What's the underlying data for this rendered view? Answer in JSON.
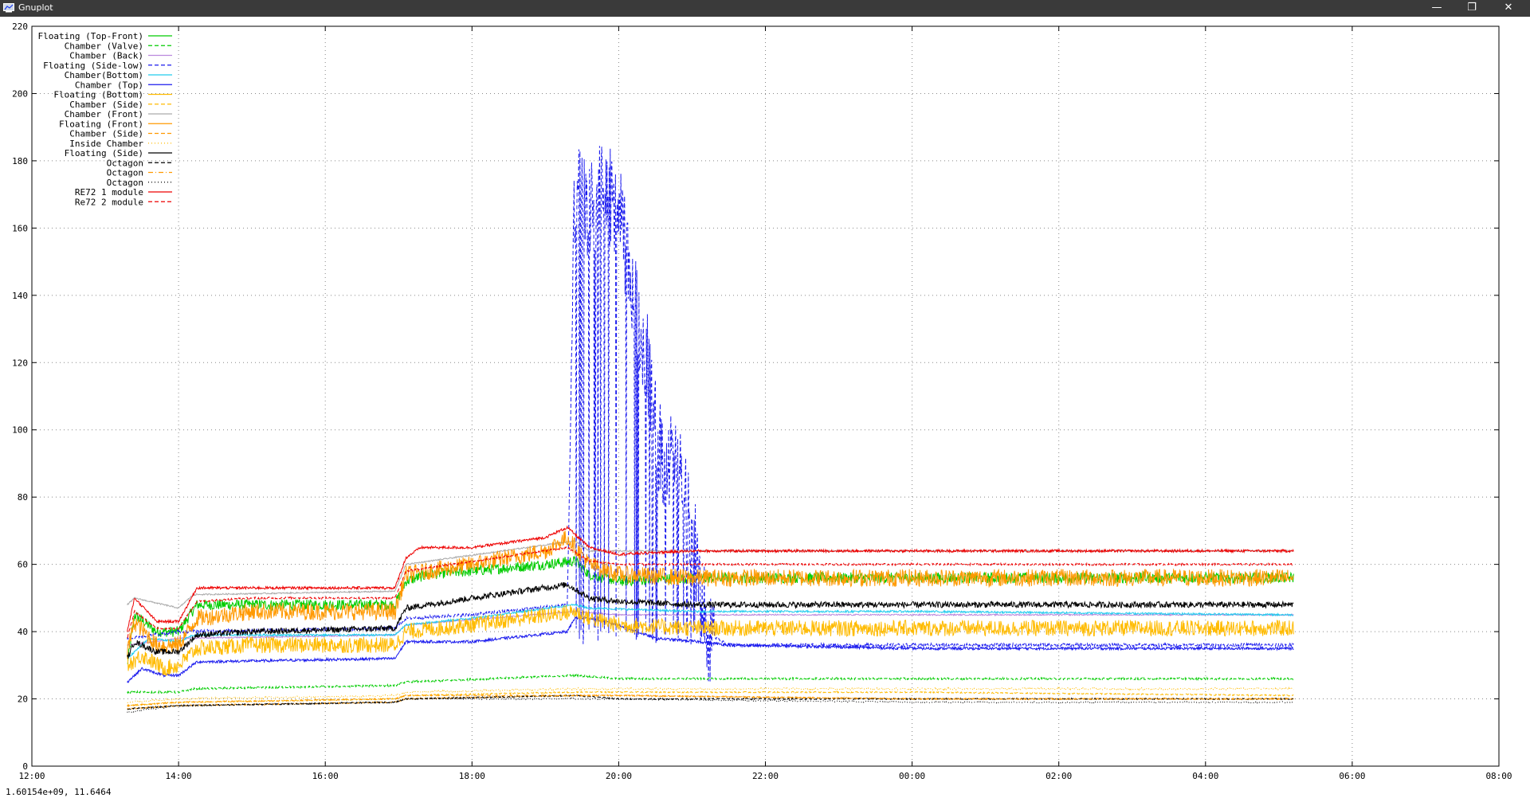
{
  "window": {
    "title": "Gnuplot",
    "minimize_icon": "minimize-icon",
    "restore_icon": "restore-icon",
    "close_icon": "close-icon"
  },
  "status": {
    "text": "1.60154e+09,  11.6464"
  },
  "chart_data": {
    "type": "line",
    "title": "",
    "xlabel": "",
    "ylabel": "",
    "x_unit": "hours since 12:00",
    "xlim": [
      0,
      20
    ],
    "ylim": [
      0,
      220
    ],
    "xticks": [
      "12:00",
      "14:00",
      "16:00",
      "18:00",
      "20:00",
      "22:00",
      "00:00",
      "02:00",
      "04:00",
      "06:00",
      "08:00"
    ],
    "yticks": [
      "0",
      "20",
      "40",
      "60",
      "80",
      "100",
      "120",
      "140",
      "160",
      "180",
      "200",
      "220"
    ],
    "grid": true,
    "legend_position": "top-left",
    "series": [
      {
        "name": "Floating (Top-Front)",
        "color": "#00cc00",
        "dash": "solid",
        "noise": 1.6,
        "points": [
          [
            1.3,
            30
          ],
          [
            1.4,
            45
          ],
          [
            1.7,
            40
          ],
          [
            2.0,
            40
          ],
          [
            2.25,
            48
          ],
          [
            3,
            48
          ],
          [
            4,
            48
          ],
          [
            4.95,
            48
          ],
          [
            5.1,
            55
          ],
          [
            5.4,
            57
          ],
          [
            6,
            58
          ],
          [
            7,
            60
          ],
          [
            7.4,
            61
          ],
          [
            7.6,
            57
          ],
          [
            8,
            55
          ],
          [
            9,
            56
          ],
          [
            11,
            56
          ],
          [
            13,
            56
          ],
          [
            15,
            56
          ],
          [
            17.2,
            56
          ]
        ]
      },
      {
        "name": "Chamber (Valve)",
        "color": "#00cc00",
        "dash": "dash",
        "noise": 0.3,
        "points": [
          [
            1.3,
            22
          ],
          [
            2,
            22
          ],
          [
            2.2,
            23
          ],
          [
            4.95,
            24
          ],
          [
            5.1,
            25
          ],
          [
            7.4,
            27
          ],
          [
            8,
            26
          ],
          [
            12,
            26
          ],
          [
            17.2,
            26
          ]
        ]
      },
      {
        "name": "Chamber (Back)",
        "color": "#bb88dd",
        "dash": "solid",
        "noise": 0.2,
        "points": [
          [
            1.3,
            36
          ],
          [
            2,
            38
          ],
          [
            4.95,
            39
          ],
          [
            5.1,
            42
          ],
          [
            7.4,
            46
          ],
          [
            8,
            45
          ],
          [
            12,
            45
          ],
          [
            17.2,
            45
          ]
        ]
      },
      {
        "name": "Floating (Side-low)",
        "color": "#1a1aee",
        "dash": "dash",
        "noise": 0.5,
        "spiky": true,
        "points": [
          [
            1.3,
            38
          ],
          [
            2,
            40
          ],
          [
            4.95,
            41
          ],
          [
            5.1,
            44
          ],
          [
            6,
            45
          ],
          [
            7.3,
            48
          ],
          [
            7.4,
            170
          ],
          [
            7.6,
            165
          ],
          [
            7.8,
            172
          ],
          [
            8,
            165
          ],
          [
            8.2,
            140
          ],
          [
            8.4,
            120
          ],
          [
            8.5,
            100
          ],
          [
            8.6,
            92
          ],
          [
            8.8,
            90
          ],
          [
            9,
            70
          ],
          [
            9.2,
            40
          ],
          [
            9.4,
            37
          ],
          [
            9.5,
            36
          ],
          [
            10,
            36
          ],
          [
            12,
            36
          ],
          [
            17.2,
            36
          ]
        ]
      },
      {
        "name": "Chamber(Bottom)",
        "color": "#22ccee",
        "dash": "solid",
        "noise": 0.3,
        "points": [
          [
            1.3,
            32
          ],
          [
            1.6,
            38
          ],
          [
            2,
            37
          ],
          [
            2.2,
            39
          ],
          [
            4.95,
            39
          ],
          [
            5.1,
            42
          ],
          [
            6,
            44
          ],
          [
            7.4,
            48
          ],
          [
            7.6,
            47
          ],
          [
            9,
            46
          ],
          [
            12,
            46
          ],
          [
            17.2,
            45
          ]
        ]
      },
      {
        "name": "Chamber (Top)",
        "color": "#1a1aee",
        "dash": "solid",
        "noise": 0.4,
        "points": [
          [
            1.3,
            25
          ],
          [
            1.5,
            29
          ],
          [
            1.8,
            27
          ],
          [
            2.0,
            27
          ],
          [
            2.25,
            31
          ],
          [
            4.95,
            32
          ],
          [
            5.1,
            37
          ],
          [
            6,
            37
          ],
          [
            7.3,
            40
          ],
          [
            7.4,
            44
          ],
          [
            7.6,
            44
          ],
          [
            8,
            42
          ],
          [
            8.5,
            38
          ],
          [
            9.1,
            37
          ],
          [
            9.5,
            36
          ],
          [
            12,
            35
          ],
          [
            17.2,
            35
          ]
        ]
      },
      {
        "name": "Floating (Bottom)",
        "color": "#ffbb00",
        "dash": "solid",
        "noise": 2.4,
        "points": [
          [
            1.3,
            30
          ],
          [
            1.5,
            33
          ],
          [
            1.8,
            29
          ],
          [
            2.0,
            30
          ],
          [
            2.25,
            35
          ],
          [
            3,
            36
          ],
          [
            4.95,
            36
          ],
          [
            5.1,
            40
          ],
          [
            6,
            42
          ],
          [
            7.4,
            46
          ],
          [
            7.6,
            44
          ],
          [
            8,
            42
          ],
          [
            9,
            41
          ],
          [
            12,
            41
          ],
          [
            17.2,
            41
          ]
        ]
      },
      {
        "name": "Chamber (Side)",
        "color": "#ffbb00",
        "dash": "dash",
        "noise": 0.2,
        "points": [
          [
            1.3,
            18
          ],
          [
            2,
            19
          ],
          [
            4.95,
            20
          ],
          [
            5.1,
            21
          ],
          [
            7.4,
            22
          ],
          [
            8,
            22
          ],
          [
            12,
            22
          ],
          [
            17.2,
            21
          ]
        ]
      },
      {
        "name": "Chamber (Front)",
        "color": "#aaaaaa",
        "dash": "solid",
        "noise": 0.2,
        "points": [
          [
            1.3,
            48
          ],
          [
            1.4,
            50
          ],
          [
            2,
            47
          ],
          [
            2.2,
            51
          ],
          [
            4.95,
            52
          ],
          [
            5.1,
            60
          ],
          [
            7.4,
            67
          ],
          [
            7.6,
            64
          ],
          [
            8,
            64
          ],
          [
            12,
            64
          ],
          [
            17.2,
            64
          ]
        ]
      },
      {
        "name": "Floating (Front)",
        "color": "#ff9900",
        "dash": "solid",
        "noise": 2.6,
        "points": [
          [
            1.3,
            34
          ],
          [
            1.4,
            43
          ],
          [
            1.7,
            36
          ],
          [
            2.0,
            36
          ],
          [
            2.25,
            44
          ],
          [
            3,
            46
          ],
          [
            4.95,
            46
          ],
          [
            5.1,
            57
          ],
          [
            6,
            60
          ],
          [
            7,
            64
          ],
          [
            7.3,
            68
          ],
          [
            7.6,
            60
          ],
          [
            8,
            57
          ],
          [
            9,
            56
          ],
          [
            12,
            56
          ],
          [
            17.2,
            56
          ]
        ]
      },
      {
        "name": "Chamber (Side)",
        "color": "#ff9900",
        "dash": "dash",
        "noise": 0.2,
        "points": [
          [
            1.3,
            17
          ],
          [
            2,
            18
          ],
          [
            4.95,
            19
          ],
          [
            5.1,
            20
          ],
          [
            7.4,
            21
          ],
          [
            8,
            21
          ],
          [
            12,
            20
          ],
          [
            17.2,
            20
          ]
        ]
      },
      {
        "name": "Inside Chamber",
        "color": "#ffbb00",
        "dash": "dot",
        "noise": 0.3,
        "points": [
          [
            1.3,
            19
          ],
          [
            2,
            20
          ],
          [
            4.95,
            21
          ],
          [
            5.1,
            22
          ],
          [
            7.4,
            23
          ],
          [
            8,
            23
          ],
          [
            12,
            23
          ],
          [
            17.2,
            23
          ]
        ]
      },
      {
        "name": "Floating (Side)",
        "color": "#000000",
        "dash": "solid",
        "noise": 0.9,
        "points": [
          [
            1.3,
            32
          ],
          [
            1.4,
            37
          ],
          [
            1.7,
            34
          ],
          [
            2.0,
            34
          ],
          [
            2.25,
            39
          ],
          [
            3,
            40
          ],
          [
            4.95,
            41
          ],
          [
            5.1,
            47
          ],
          [
            6,
            50
          ],
          [
            7.3,
            54
          ],
          [
            7.6,
            50
          ],
          [
            8,
            49
          ],
          [
            9,
            48
          ],
          [
            12,
            48
          ],
          [
            17.2,
            48
          ]
        ]
      },
      {
        "name": "Octagon",
        "color": "#000000",
        "dash": "dash",
        "noise": 0.2,
        "points": [
          [
            1.3,
            17
          ],
          [
            2,
            18
          ],
          [
            4.95,
            19
          ],
          [
            5.1,
            20
          ],
          [
            7.4,
            21
          ],
          [
            8,
            20
          ],
          [
            12,
            20
          ],
          [
            17.2,
            20
          ]
        ]
      },
      {
        "name": "Octagon",
        "color": "#ff9900",
        "dash": "dashdot",
        "noise": 0.2,
        "points": [
          [
            1.3,
            18
          ],
          [
            2,
            19
          ],
          [
            4.95,
            20
          ],
          [
            5.1,
            21
          ],
          [
            7.4,
            21
          ],
          [
            8,
            21
          ],
          [
            12,
            20
          ],
          [
            17.2,
            20
          ]
        ]
      },
      {
        "name": "Octagon",
        "color": "#000000",
        "dash": "dot",
        "noise": 0.2,
        "points": [
          [
            1.3,
            16
          ],
          [
            2,
            18
          ],
          [
            4.95,
            19
          ],
          [
            5.1,
            20
          ],
          [
            7.4,
            20
          ],
          [
            8,
            20
          ],
          [
            12,
            19
          ],
          [
            17.2,
            19
          ]
        ]
      },
      {
        "name": "RE72 1 module",
        "color": "#ee0000",
        "dash": "solid",
        "noise": 0.4,
        "points": [
          [
            1.3,
            40
          ],
          [
            1.4,
            50
          ],
          [
            1.7,
            43
          ],
          [
            2.0,
            43
          ],
          [
            2.25,
            53
          ],
          [
            3,
            53
          ],
          [
            4.95,
            53
          ],
          [
            5.1,
            62
          ],
          [
            5.3,
            65
          ],
          [
            6,
            65
          ],
          [
            7,
            68
          ],
          [
            7.3,
            71
          ],
          [
            7.6,
            65
          ],
          [
            8,
            63
          ],
          [
            9,
            64
          ],
          [
            12,
            64
          ],
          [
            17.2,
            64
          ]
        ]
      },
      {
        "name": "Re72 2 module",
        "color": "#ee0000",
        "dash": "dash",
        "noise": 0.3,
        "points": [
          [
            1.3,
            38
          ],
          [
            1.4,
            46
          ],
          [
            1.7,
            41
          ],
          [
            2.0,
            41
          ],
          [
            2.25,
            49
          ],
          [
            3,
            50
          ],
          [
            4.95,
            50
          ],
          [
            5.1,
            58
          ],
          [
            7.3,
            65
          ],
          [
            7.6,
            61
          ],
          [
            8,
            60
          ],
          [
            12,
            60
          ],
          [
            17.2,
            60
          ]
        ]
      }
    ]
  }
}
